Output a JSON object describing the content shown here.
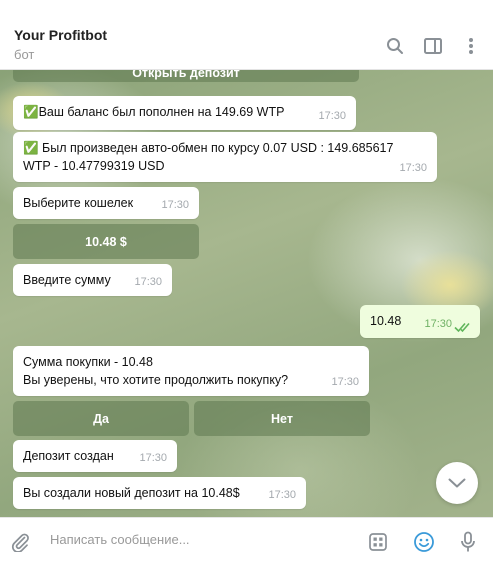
{
  "header": {
    "title": "Your Profitbot",
    "subtitle": "бот",
    "icons": [
      "search-icon",
      "sidebar-toggle-icon",
      "more-vertical-icon"
    ]
  },
  "messages": {
    "top_button_label": "Открыть депозит",
    "balance": {
      "text": "✅Ваш баланс был пополнен на 149.69 WTP",
      "time": "17:30"
    },
    "exchange": {
      "line1": "✅ Был произведен авто-обмен по курсу 0.07 USD : 149.685617",
      "line2": "WTP -  10.47799319 USD",
      "time": "17:30"
    },
    "choose_wallet": {
      "text": "Выберите кошелек",
      "time": "17:30"
    },
    "amount_button_label": "10.48 $",
    "enter_amount": {
      "text": "Введите сумму",
      "time": "17:30"
    },
    "outgoing": {
      "text": "10.48",
      "time": "17:30",
      "status": "read"
    },
    "confirm": {
      "line1": "Сумма покупки - 10.48",
      "line2": "Вы уверены, что хотите продолжить покупку?",
      "time": "17:30"
    },
    "yes_label": "Да",
    "no_label": "Нет",
    "deposit_created": {
      "text": "Депозит создан",
      "time": "17:30"
    },
    "new_deposit": {
      "text": "Вы создали новый депозит на 10.48$",
      "time": "17:30"
    }
  },
  "composer": {
    "placeholder": "Написать сообщение...",
    "icons": [
      "paperclip-icon",
      "bot-commands-icon",
      "emoji-icon",
      "microphone-icon"
    ]
  },
  "colors": {
    "accent": "#3a9ad9",
    "read_check": "#5fb55a",
    "outgoing_bubble": "#effdde"
  }
}
